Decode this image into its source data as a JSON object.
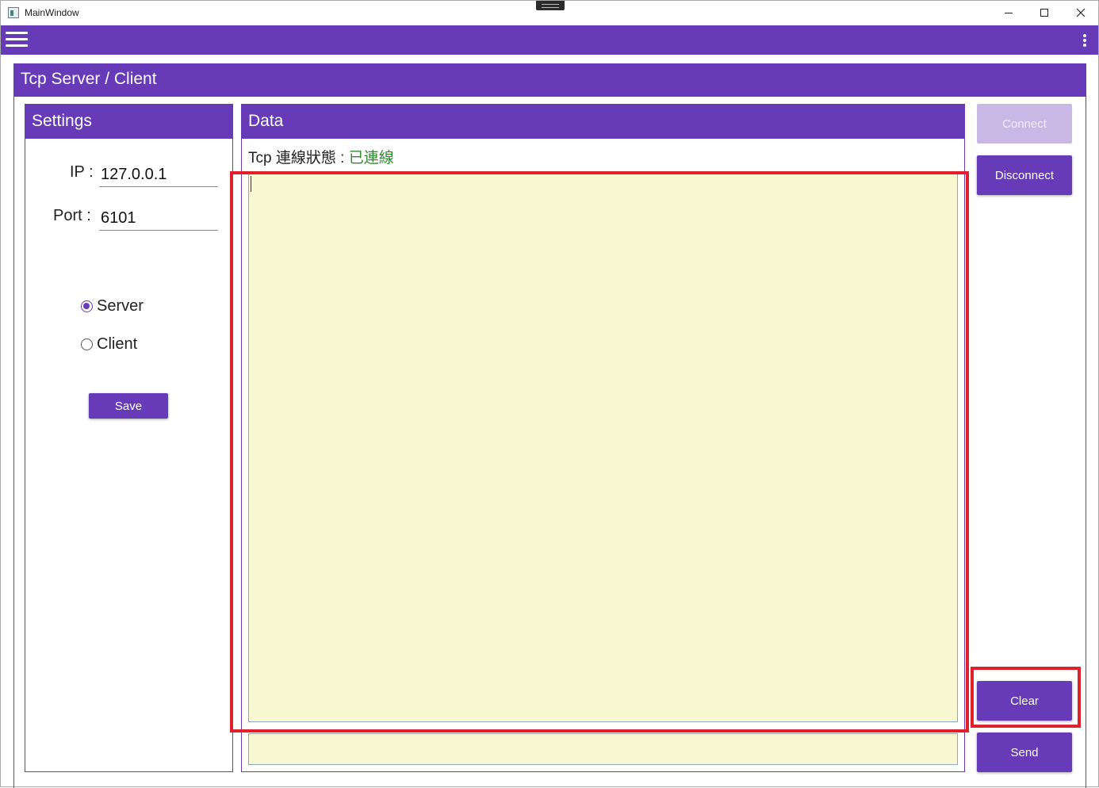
{
  "window": {
    "title": "MainWindow"
  },
  "appbar": {
    "menu_icon": "hamburger-icon",
    "more_icon": "more-vertical-icon"
  },
  "main": {
    "title": "Tcp Server / Client"
  },
  "settings": {
    "title": "Settings",
    "ip_label": "IP :",
    "ip_value": "127.0.0.1",
    "port_label": "Port :",
    "port_value": "6101",
    "mode_options": [
      {
        "label": "Server",
        "checked": true
      },
      {
        "label": "Client",
        "checked": false
      }
    ],
    "save_label": "Save"
  },
  "data": {
    "title": "Data",
    "status_label": "Tcp 連線狀態 :",
    "status_value": "已連線",
    "received_text": "",
    "send_text": ""
  },
  "actions": {
    "connect_label": "Connect",
    "connect_enabled": false,
    "disconnect_label": "Disconnect",
    "clear_label": "Clear",
    "send_label": "Send"
  },
  "colors": {
    "primary": "#673ab7",
    "primary_disabled": "#c9b8e6",
    "status_connected": "#2e8b2e",
    "textarea_bg": "#f7f8d2",
    "highlight": "#e0202a"
  }
}
